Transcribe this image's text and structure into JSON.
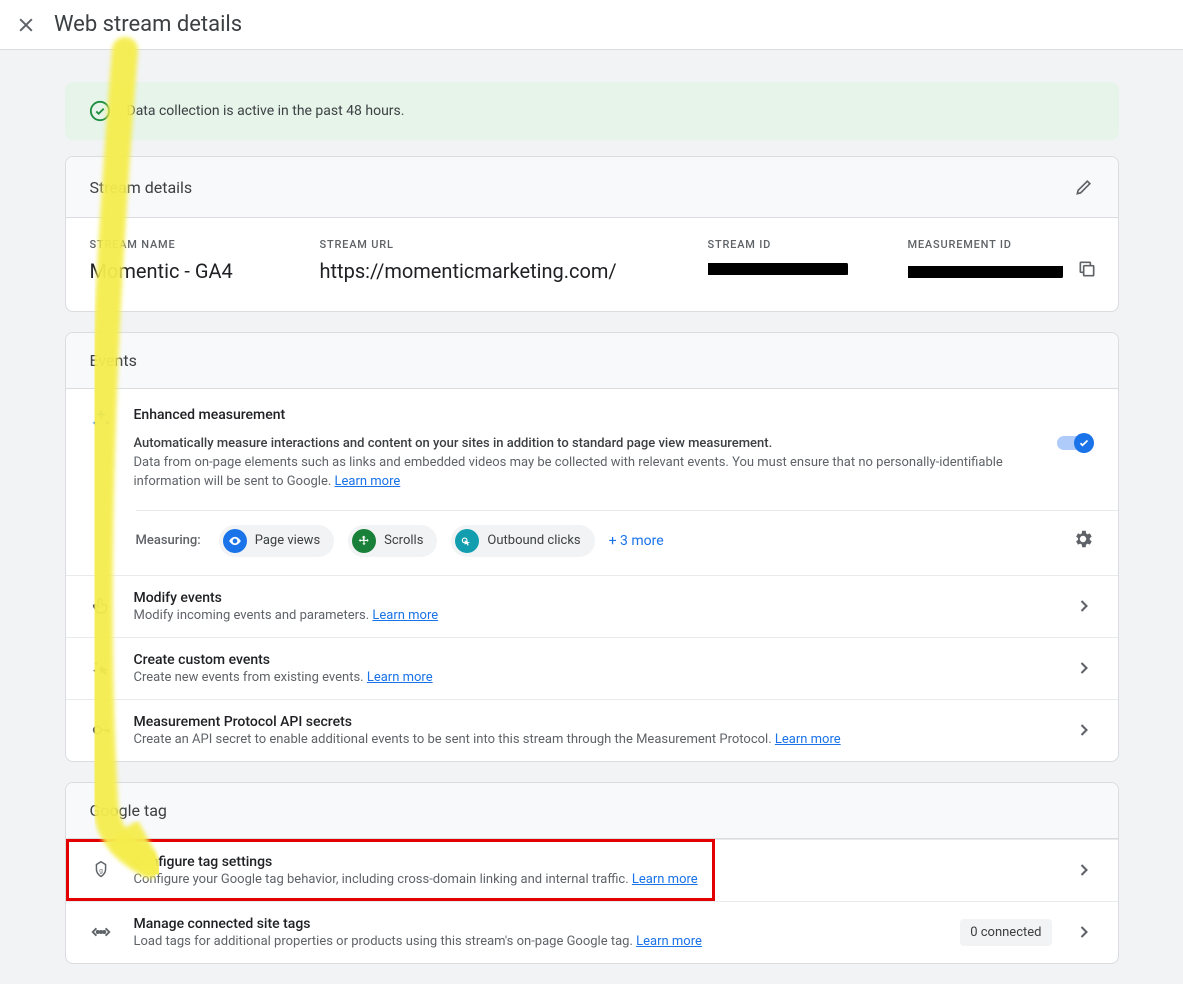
{
  "header": {
    "title": "Web stream details"
  },
  "banner": {
    "text": "Data collection is active in the past 48 hours."
  },
  "streamDetails": {
    "title": "Stream details",
    "name": {
      "label": "STREAM NAME",
      "value": "Momentic - GA4"
    },
    "url": {
      "label": "STREAM URL",
      "value": "https://momenticmarketing.com/"
    },
    "streamId": {
      "label": "STREAM ID"
    },
    "measurementId": {
      "label": "MEASUREMENT ID"
    }
  },
  "events": {
    "title": "Events",
    "enhanced": {
      "title": "Enhanced measurement",
      "desc1": "Automatically measure interactions and content on your sites in addition to standard page view measurement.",
      "desc2": "Data from on-page elements such as links and embedded videos may be collected with relevant events. You must ensure that no personally-identifiable information will be sent to Google. ",
      "learn": "Learn more"
    },
    "measuring": {
      "label": "Measuring:",
      "chips": [
        {
          "label": "Page views"
        },
        {
          "label": "Scrolls"
        },
        {
          "label": "Outbound clicks"
        }
      ],
      "more": "+ 3 more"
    },
    "rows": [
      {
        "title": "Modify events",
        "desc": "Modify incoming events and parameters. ",
        "learn": "Learn more"
      },
      {
        "title": "Create custom events",
        "desc": "Create new events from existing events. ",
        "learn": "Learn more"
      },
      {
        "title": "Measurement Protocol API secrets",
        "desc": "Create an API secret to enable additional events to be sent into this stream through the Measurement Protocol. ",
        "learn": "Learn more"
      }
    ]
  },
  "googleTag": {
    "title": "Google tag",
    "rows": [
      {
        "title": "Configure tag settings",
        "desc": "Configure your Google tag behavior, including cross-domain linking and internal traffic. ",
        "learn": "Learn more"
      },
      {
        "title": "Manage connected site tags",
        "desc": "Load tags for additional properties or products using this stream's on-page Google tag. ",
        "learn": "Learn more",
        "badge": "0 connected"
      }
    ]
  }
}
